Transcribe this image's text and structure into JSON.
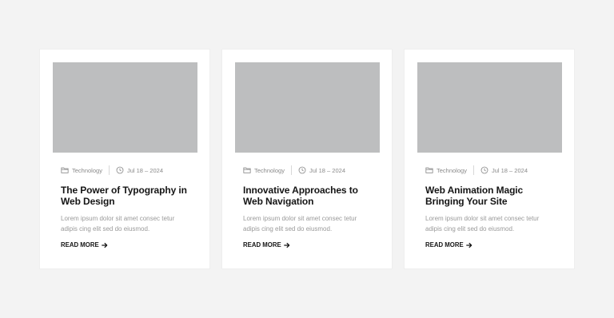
{
  "cards": [
    {
      "category": "Technology",
      "date": "Jul 18 – 2024",
      "title_line1": "The Power of Typography in",
      "title_line2": "Web Design",
      "excerpt_line1": "Lorem ipsum dolor sit amet consec tetur",
      "excerpt_line2": "adipis cing elit sed do eiusmod.",
      "read_more": "READ MORE"
    },
    {
      "category": "Technology",
      "date": "Jul 18 – 2024",
      "title_line1": "Innovative Approaches to",
      "title_line2": "Web Navigation",
      "excerpt_line1": "Lorem ipsum dolor sit amet consec tetur",
      "excerpt_line2": "adipis cing elit sed do eiusmod.",
      "read_more": "READ MORE"
    },
    {
      "category": "Technology",
      "date": "Jul 18 – 2024",
      "title_line1": "Web Animation Magic",
      "title_line2": "Bringing Your Site",
      "excerpt_line1": "Lorem ipsum dolor sit amet consec tetur",
      "excerpt_line2": "adipis cing elit sed do eiusmod.",
      "read_more": "READ MORE"
    }
  ],
  "icons": {
    "category": "folder-icon",
    "date": "clock-icon",
    "read_more": "arrow-right-icon"
  },
  "colors": {
    "background": "#f3f3f3",
    "card": "#ffffff",
    "thumbnail": "#bdbebf",
    "title": "#151515",
    "muted": "#8a8a8a"
  }
}
